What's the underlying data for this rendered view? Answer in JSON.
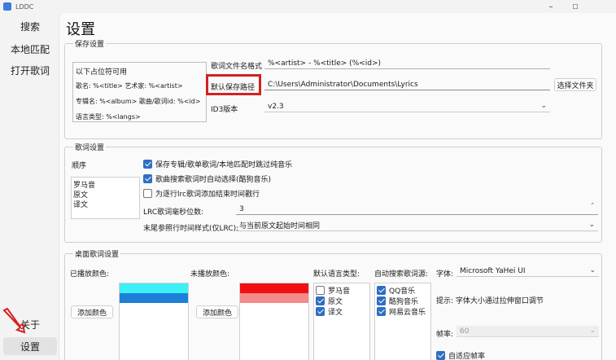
{
  "window": {
    "title": "LDDC",
    "minimize": "–",
    "maximize": "☐"
  },
  "sidebar": {
    "items": [
      {
        "label": "搜索"
      },
      {
        "label": "本地匹配"
      },
      {
        "label": "打开歌词"
      }
    ],
    "about": "关于",
    "settings": "设置"
  },
  "page_title": "设置",
  "save": {
    "title": "保存设置",
    "placeholders_title": "以下占位符可用",
    "placeholders": [
      "歌名: %<title> 艺术家: %<artist>",
      "专辑名: %<album> 歌曲/歌词id: %<id>",
      "语言类型: %<langs>"
    ],
    "filename_label": "歌词文件名格式",
    "filename_value": "%<artist> - %<title> (%<id>)",
    "path_label": "默认保存路径",
    "path_value": "C:\\Users\\Administrator\\Documents\\Lyrics",
    "choose_folder": "选择文件夹",
    "id3_label": "ID3版本",
    "id3_value": "v2.3"
  },
  "lyrics": {
    "title": "歌词设置",
    "order_label": "顺序",
    "order_items": [
      "罗马音",
      "原文",
      "译文"
    ],
    "opt1": "保存专辑/歌单歌词/本地匹配时跳过纯音乐",
    "opt2": "歌曲搜索歌词时自动选择(酷狗音乐)",
    "opt3": "为逐行lrc歌词添加结束时间戳行",
    "ms_label": "LRC歌词毫秒位数:",
    "ms_value": "3",
    "endtime_label": "末尾参照行时间样式(仅LRC):",
    "endtime_value": "与当前原文起始时间相同"
  },
  "desktop": {
    "title": "桌面歌词设置",
    "played_label": "已播放颜色:",
    "unplayed_label": "未播放颜色:",
    "add_color": "添加颜色",
    "played_colors": [
      "#3df0f5",
      "#1e7fd8"
    ],
    "unplayed_colors": [
      "#f01010",
      "#f58a8a"
    ],
    "default_lang_label": "默认语言类型:",
    "default_langs": [
      {
        "label": "罗马音",
        "checked": false
      },
      {
        "label": "原文",
        "checked": true
      },
      {
        "label": "译文",
        "checked": true
      }
    ],
    "auto_source_label": "自动搜索歌词源:",
    "sources": [
      {
        "label": "QQ音乐",
        "checked": true
      },
      {
        "label": "酷狗音乐",
        "checked": true
      },
      {
        "label": "网易云音乐",
        "checked": true
      }
    ],
    "font_label": "字体:",
    "font_value": "Microsoft YaHei UI",
    "hint": "提示: 字体大小通过拉伸窗口调节",
    "fps_label": "帧率:",
    "fps_value": "60",
    "adaptive": "自适应帧率"
  }
}
